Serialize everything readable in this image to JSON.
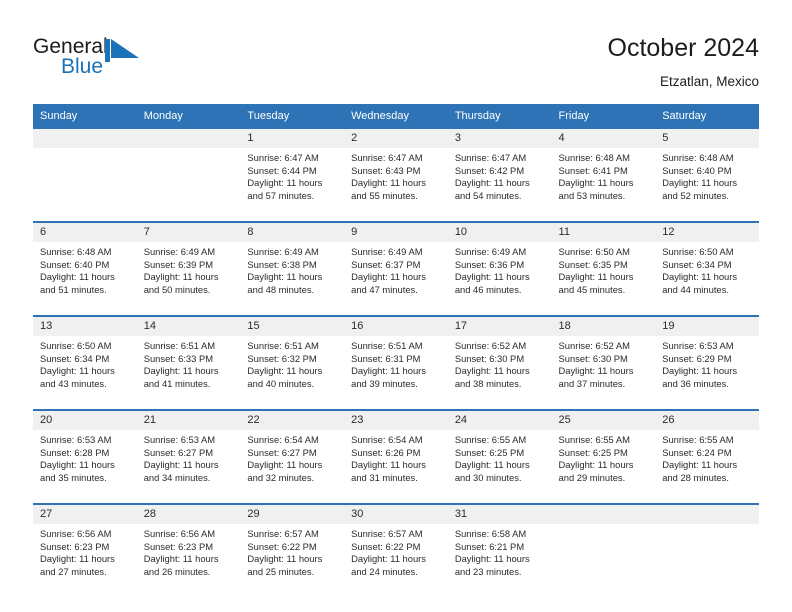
{
  "brand": {
    "name_part1": "General",
    "name_part2": "Blue",
    "flag_icon": "flag-triangle-icon",
    "accent_color": "#1b72b8"
  },
  "header": {
    "title": "October 2024",
    "subtitle": "Etzatlan, Mexico"
  },
  "theme": {
    "header_blue": "#2e73b5",
    "daynum_band": "#f0f0f0",
    "text": "#2b2b2b"
  },
  "calendar": {
    "weekday_headers": [
      "Sunday",
      "Monday",
      "Tuesday",
      "Wednesday",
      "Thursday",
      "Friday",
      "Saturday"
    ],
    "weeks": [
      [
        {
          "day": "",
          "sunrise": "",
          "sunset": "",
          "daylight_line1": "",
          "daylight_line2": ""
        },
        {
          "day": "",
          "sunrise": "",
          "sunset": "",
          "daylight_line1": "",
          "daylight_line2": ""
        },
        {
          "day": "1",
          "sunrise": "Sunrise: 6:47 AM",
          "sunset": "Sunset: 6:44 PM",
          "daylight_line1": "Daylight: 11 hours",
          "daylight_line2": "and 57 minutes."
        },
        {
          "day": "2",
          "sunrise": "Sunrise: 6:47 AM",
          "sunset": "Sunset: 6:43 PM",
          "daylight_line1": "Daylight: 11 hours",
          "daylight_line2": "and 55 minutes."
        },
        {
          "day": "3",
          "sunrise": "Sunrise: 6:47 AM",
          "sunset": "Sunset: 6:42 PM",
          "daylight_line1": "Daylight: 11 hours",
          "daylight_line2": "and 54 minutes."
        },
        {
          "day": "4",
          "sunrise": "Sunrise: 6:48 AM",
          "sunset": "Sunset: 6:41 PM",
          "daylight_line1": "Daylight: 11 hours",
          "daylight_line2": "and 53 minutes."
        },
        {
          "day": "5",
          "sunrise": "Sunrise: 6:48 AM",
          "sunset": "Sunset: 6:40 PM",
          "daylight_line1": "Daylight: 11 hours",
          "daylight_line2": "and 52 minutes."
        }
      ],
      [
        {
          "day": "6",
          "sunrise": "Sunrise: 6:48 AM",
          "sunset": "Sunset: 6:40 PM",
          "daylight_line1": "Daylight: 11 hours",
          "daylight_line2": "and 51 minutes."
        },
        {
          "day": "7",
          "sunrise": "Sunrise: 6:49 AM",
          "sunset": "Sunset: 6:39 PM",
          "daylight_line1": "Daylight: 11 hours",
          "daylight_line2": "and 50 minutes."
        },
        {
          "day": "8",
          "sunrise": "Sunrise: 6:49 AM",
          "sunset": "Sunset: 6:38 PM",
          "daylight_line1": "Daylight: 11 hours",
          "daylight_line2": "and 48 minutes."
        },
        {
          "day": "9",
          "sunrise": "Sunrise: 6:49 AM",
          "sunset": "Sunset: 6:37 PM",
          "daylight_line1": "Daylight: 11 hours",
          "daylight_line2": "and 47 minutes."
        },
        {
          "day": "10",
          "sunrise": "Sunrise: 6:49 AM",
          "sunset": "Sunset: 6:36 PM",
          "daylight_line1": "Daylight: 11 hours",
          "daylight_line2": "and 46 minutes."
        },
        {
          "day": "11",
          "sunrise": "Sunrise: 6:50 AM",
          "sunset": "Sunset: 6:35 PM",
          "daylight_line1": "Daylight: 11 hours",
          "daylight_line2": "and 45 minutes."
        },
        {
          "day": "12",
          "sunrise": "Sunrise: 6:50 AM",
          "sunset": "Sunset: 6:34 PM",
          "daylight_line1": "Daylight: 11 hours",
          "daylight_line2": "and 44 minutes."
        }
      ],
      [
        {
          "day": "13",
          "sunrise": "Sunrise: 6:50 AM",
          "sunset": "Sunset: 6:34 PM",
          "daylight_line1": "Daylight: 11 hours",
          "daylight_line2": "and 43 minutes."
        },
        {
          "day": "14",
          "sunrise": "Sunrise: 6:51 AM",
          "sunset": "Sunset: 6:33 PM",
          "daylight_line1": "Daylight: 11 hours",
          "daylight_line2": "and 41 minutes."
        },
        {
          "day": "15",
          "sunrise": "Sunrise: 6:51 AM",
          "sunset": "Sunset: 6:32 PM",
          "daylight_line1": "Daylight: 11 hours",
          "daylight_line2": "and 40 minutes."
        },
        {
          "day": "16",
          "sunrise": "Sunrise: 6:51 AM",
          "sunset": "Sunset: 6:31 PM",
          "daylight_line1": "Daylight: 11 hours",
          "daylight_line2": "and 39 minutes."
        },
        {
          "day": "17",
          "sunrise": "Sunrise: 6:52 AM",
          "sunset": "Sunset: 6:30 PM",
          "daylight_line1": "Daylight: 11 hours",
          "daylight_line2": "and 38 minutes."
        },
        {
          "day": "18",
          "sunrise": "Sunrise: 6:52 AM",
          "sunset": "Sunset: 6:30 PM",
          "daylight_line1": "Daylight: 11 hours",
          "daylight_line2": "and 37 minutes."
        },
        {
          "day": "19",
          "sunrise": "Sunrise: 6:53 AM",
          "sunset": "Sunset: 6:29 PM",
          "daylight_line1": "Daylight: 11 hours",
          "daylight_line2": "and 36 minutes."
        }
      ],
      [
        {
          "day": "20",
          "sunrise": "Sunrise: 6:53 AM",
          "sunset": "Sunset: 6:28 PM",
          "daylight_line1": "Daylight: 11 hours",
          "daylight_line2": "and 35 minutes."
        },
        {
          "day": "21",
          "sunrise": "Sunrise: 6:53 AM",
          "sunset": "Sunset: 6:27 PM",
          "daylight_line1": "Daylight: 11 hours",
          "daylight_line2": "and 34 minutes."
        },
        {
          "day": "22",
          "sunrise": "Sunrise: 6:54 AM",
          "sunset": "Sunset: 6:27 PM",
          "daylight_line1": "Daylight: 11 hours",
          "daylight_line2": "and 32 minutes."
        },
        {
          "day": "23",
          "sunrise": "Sunrise: 6:54 AM",
          "sunset": "Sunset: 6:26 PM",
          "daylight_line1": "Daylight: 11 hours",
          "daylight_line2": "and 31 minutes."
        },
        {
          "day": "24",
          "sunrise": "Sunrise: 6:55 AM",
          "sunset": "Sunset: 6:25 PM",
          "daylight_line1": "Daylight: 11 hours",
          "daylight_line2": "and 30 minutes."
        },
        {
          "day": "25",
          "sunrise": "Sunrise: 6:55 AM",
          "sunset": "Sunset: 6:25 PM",
          "daylight_line1": "Daylight: 11 hours",
          "daylight_line2": "and 29 minutes."
        },
        {
          "day": "26",
          "sunrise": "Sunrise: 6:55 AM",
          "sunset": "Sunset: 6:24 PM",
          "daylight_line1": "Daylight: 11 hours",
          "daylight_line2": "and 28 minutes."
        }
      ],
      [
        {
          "day": "27",
          "sunrise": "Sunrise: 6:56 AM",
          "sunset": "Sunset: 6:23 PM",
          "daylight_line1": "Daylight: 11 hours",
          "daylight_line2": "and 27 minutes."
        },
        {
          "day": "28",
          "sunrise": "Sunrise: 6:56 AM",
          "sunset": "Sunset: 6:23 PM",
          "daylight_line1": "Daylight: 11 hours",
          "daylight_line2": "and 26 minutes."
        },
        {
          "day": "29",
          "sunrise": "Sunrise: 6:57 AM",
          "sunset": "Sunset: 6:22 PM",
          "daylight_line1": "Daylight: 11 hours",
          "daylight_line2": "and 25 minutes."
        },
        {
          "day": "30",
          "sunrise": "Sunrise: 6:57 AM",
          "sunset": "Sunset: 6:22 PM",
          "daylight_line1": "Daylight: 11 hours",
          "daylight_line2": "and 24 minutes."
        },
        {
          "day": "31",
          "sunrise": "Sunrise: 6:58 AM",
          "sunset": "Sunset: 6:21 PM",
          "daylight_line1": "Daylight: 11 hours",
          "daylight_line2": "and 23 minutes."
        },
        {
          "day": "",
          "sunrise": "",
          "sunset": "",
          "daylight_line1": "",
          "daylight_line2": ""
        },
        {
          "day": "",
          "sunrise": "",
          "sunset": "",
          "daylight_line1": "",
          "daylight_line2": ""
        }
      ]
    ]
  }
}
